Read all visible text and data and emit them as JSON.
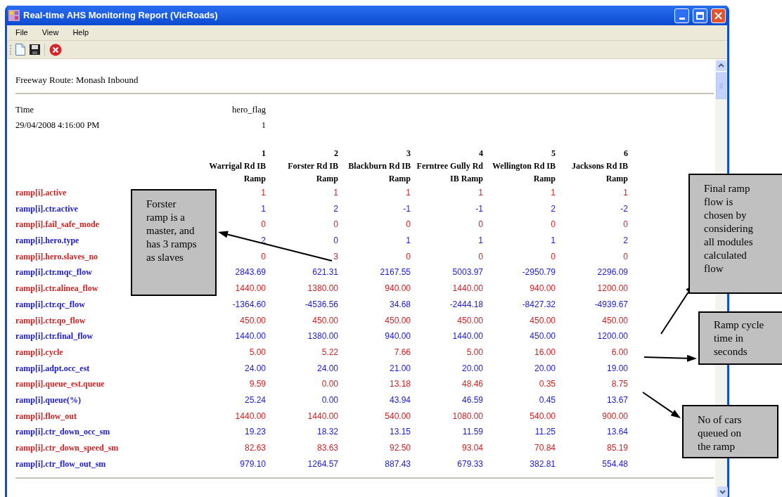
{
  "window": {
    "title": "Real-time AHS Monitoring Report (VicRoads)"
  },
  "menu": [
    "File",
    "View",
    "Help"
  ],
  "route": "Freeway Route: Monash Inbound",
  "summary": {
    "headers": [
      "Time",
      "hero_flag"
    ],
    "values": [
      "29/04/2008 4:16:00 PM",
      "1"
    ]
  },
  "table": {
    "columns": [
      {
        "number": "1",
        "name": "Warrigal Rd IB Ramp"
      },
      {
        "number": "2",
        "name": "Forster Rd IB Ramp"
      },
      {
        "number": "3",
        "name": "Blackburn Rd IB Ramp"
      },
      {
        "number": "4",
        "name": "Ferntree Gully Rd IB Ramp"
      },
      {
        "number": "5",
        "name": "Wellington Rd IB Ramp"
      },
      {
        "number": "6",
        "name": "Jacksons Rd IB Ramp"
      }
    ],
    "rows": [
      {
        "label": "ramp[i].active",
        "color": "#cc2222",
        "values": [
          "1",
          "1",
          "1",
          "1",
          "1",
          "1"
        ]
      },
      {
        "label": "ramp[i].ctr.active",
        "color": "#1a1acc",
        "values": [
          "1",
          "2",
          "-1",
          "-1",
          "2",
          "-2"
        ]
      },
      {
        "label": "ramp[i].fail_safe_mode",
        "color": "#cc2222",
        "values": [
          "0",
          "0",
          "0",
          "0",
          "0",
          "0"
        ]
      },
      {
        "label": "ramp[i].hero.type",
        "color": "#1a1acc",
        "values": [
          "2",
          "0",
          "1",
          "1",
          "1",
          "2"
        ]
      },
      {
        "label": "ramp[i].hero.slaves_no",
        "color": "#cc2222",
        "values": [
          "0",
          "3",
          "0",
          "0",
          "0",
          "0"
        ]
      },
      {
        "label": "ramp[i].ctr.mqc_flow",
        "color": "#1a1acc",
        "values": [
          "2843.69",
          "621.31",
          "2167.55",
          "5003.97",
          "-2950.79",
          "2296.09"
        ]
      },
      {
        "label": "ramp[i].ctr.alinea_flow",
        "color": "#cc2222",
        "values": [
          "1440.00",
          "1380.00",
          "940.00",
          "1440.00",
          "940.00",
          "1200.00"
        ]
      },
      {
        "label": "ramp[i].ctr.qc_flow",
        "color": "#1a1acc",
        "values": [
          "-1364.60",
          "-4536.56",
          "34.68",
          "-2444.18",
          "-8427.32",
          "-4939.67"
        ]
      },
      {
        "label": "ramp[i].ctr.qo_flow",
        "color": "#cc2222",
        "values": [
          "450.00",
          "450.00",
          "450.00",
          "450.00",
          "450.00",
          "450.00"
        ]
      },
      {
        "label": "ramp[i].ctr.final_flow",
        "color": "#1a1acc",
        "values": [
          "1440.00",
          "1380.00",
          "940.00",
          "1440.00",
          "450.00",
          "1200.00"
        ]
      },
      {
        "label": "ramp[i].cycle",
        "color": "#cc2222",
        "values": [
          "5.00",
          "5.22",
          "7.66",
          "5.00",
          "16.00",
          "6.00"
        ]
      },
      {
        "label": "ramp[i].adpt.occ_est",
        "color": "#1a1acc",
        "values": [
          "24.00",
          "24.00",
          "21.00",
          "20.00",
          "20.00",
          "19.00"
        ]
      },
      {
        "label": "ramp[i].queue_est.queue",
        "color": "#cc2222",
        "values": [
          "9.59",
          "0.00",
          "13.18",
          "48.46",
          "0.35",
          "8.75"
        ]
      },
      {
        "label": "ramp[i].queue(%)",
        "color": "#1a1acc",
        "values": [
          "25.24",
          "0.00",
          "43.94",
          "46.59",
          "0.45",
          "13.67"
        ]
      },
      {
        "label": "ramp[i].flow_out",
        "color": "#cc2222",
        "values": [
          "1440.00",
          "1440.00",
          "540.00",
          "1080.00",
          "540.00",
          "900.00"
        ]
      },
      {
        "label": "ramp[i].ctr_down_occ_sm",
        "color": "#1a1acc",
        "values": [
          "19.23",
          "18.32",
          "13.15",
          "11.59",
          "11.25",
          "13.64"
        ]
      },
      {
        "label": "ramp[i].ctr_down_speed_sm",
        "color": "#cc2222",
        "values": [
          "82.63",
          "83.63",
          "92.50",
          "93.04",
          "70.84",
          "85.19"
        ]
      },
      {
        "label": "ramp[i].ctr_flow_out_sm",
        "color": "#1a1acc",
        "values": [
          "979.10",
          "1264.57",
          "887.43",
          "679.33",
          "382.81",
          "554.48"
        ]
      }
    ]
  },
  "callouts": [
    {
      "text": "Forster ramp is a master, and has 3 ramps as slaves"
    },
    {
      "text": "Final ramp flow is chosen by considering all modules calculated flow"
    },
    {
      "text": "Ramp cycle time in seconds"
    },
    {
      "text": "No of cars queued on the ramp"
    }
  ]
}
